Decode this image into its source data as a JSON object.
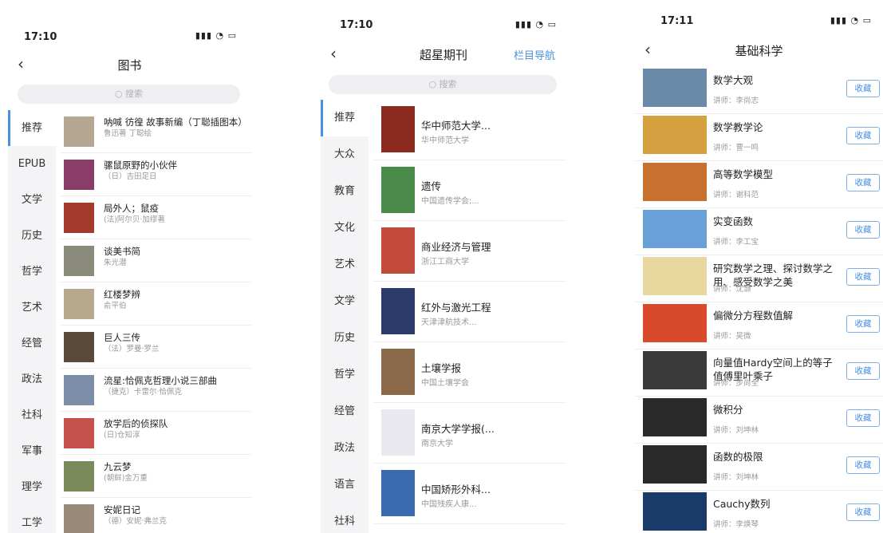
{
  "screen1": {
    "time": "17:10",
    "title": "图书",
    "search_placeholder": "搜索",
    "categories": [
      "推荐",
      "EPUB",
      "文学",
      "历史",
      "哲学",
      "艺术",
      "经管",
      "政法",
      "社科",
      "军事",
      "理学",
      "工学"
    ],
    "books": [
      {
        "title": "呐喊 彷徨 故事新编（丁聪插图本）",
        "author": "鲁迅著 丁聪绘",
        "color": "#b5a792"
      },
      {
        "title": "骡鼠原野的小伙伴",
        "author": "（日）吉田足日",
        "color": "#8b3d6a"
      },
      {
        "title": "局外人；鼠疫",
        "author": "(法)阿尔贝·加缪著",
        "color": "#a33a2c"
      },
      {
        "title": "谈美书简",
        "author": "朱光潜",
        "color": "#8a8a7a"
      },
      {
        "title": "红楼梦辨",
        "author": "俞平伯",
        "color": "#b8a98c"
      },
      {
        "title": "巨人三传",
        "author": "（法）罗曼·罗兰",
        "color": "#5a4a3a"
      },
      {
        "title": "流星:恰佩克哲理小说三部曲",
        "author": "（捷克）卡雷尔·恰佩克",
        "color": "#7d8fa8"
      },
      {
        "title": "放学后的侦探队",
        "author": "(日)仓知淳",
        "color": "#c4514a"
      },
      {
        "title": "九云梦",
        "author": "(朝鲜)金万重",
        "color": "#7a8a5a"
      },
      {
        "title": "安妮日记",
        "author": "（德）安妮·弗兰克",
        "color": "#9a8a7a"
      }
    ]
  },
  "screen2": {
    "time": "17:10",
    "title": "超星期刊",
    "nav_right": "栏目导航",
    "search_placeholder": "搜索",
    "categories": [
      "推荐",
      "大众",
      "教育",
      "文化",
      "艺术",
      "文学",
      "历史",
      "哲学",
      "经管",
      "政法",
      "语言",
      "社科"
    ],
    "journals": [
      {
        "title": "华中师范大学...",
        "publisher": "华中师范大学",
        "color": "#8b2a1e"
      },
      {
        "title": "遗传",
        "publisher": "中国遗传学会;...",
        "color": "#4a8a4a"
      },
      {
        "title": "商业经济与管理",
        "publisher": "浙江工商大学",
        "color": "#c24a3a"
      },
      {
        "title": "红外与激光工程",
        "publisher": "天津津航技术...",
        "color": "#2a3a6a"
      },
      {
        "title": "土壤学报",
        "publisher": "中国土壤学会",
        "color": "#8a6a4a"
      },
      {
        "title": "南京大学学报(...",
        "publisher": "南京大学",
        "color": "#e8e8ee"
      },
      {
        "title": "中国矫形外科...",
        "publisher": "中国残疾人康...",
        "color": "#3a6ab0"
      }
    ]
  },
  "screen3": {
    "time": "17:11",
    "title": "基础科学",
    "fav_label": "收藏",
    "courses": [
      {
        "title": "数学大观",
        "lecturer": "讲师：李尚志",
        "color": "#6a8aa8"
      },
      {
        "title": "数学教学论",
        "lecturer": "讲师：曹一鸣",
        "color": "#d4a040"
      },
      {
        "title": "高等数学模型",
        "lecturer": "讲师：谢科范",
        "color": "#c87030"
      },
      {
        "title": "实变函数",
        "lecturer": "讲师：李工宝",
        "color": "#6aa0d8"
      },
      {
        "title": "研究数学之理、探讨数学之用、感受数学之美",
        "lecturer": "讲师：沈灏",
        "color": "#e8d8a0"
      },
      {
        "title": "偏微分方程数值解",
        "lecturer": "讲师：吴微",
        "color": "#d84a2a"
      },
      {
        "title": "向量值Hardy空间上的等子值傅里叶乘子",
        "lecturer": "讲师：步尚全",
        "color": "#3a3a3a"
      },
      {
        "title": "微积分",
        "lecturer": "讲师：刘坤林",
        "color": "#2a2a2a"
      },
      {
        "title": "函数的极限",
        "lecturer": "讲师：刘坤林",
        "color": "#2a2a2a"
      },
      {
        "title": "Cauchy数列",
        "lecturer": "讲师：李焕琴",
        "color": "#1a3a6a"
      }
    ]
  }
}
